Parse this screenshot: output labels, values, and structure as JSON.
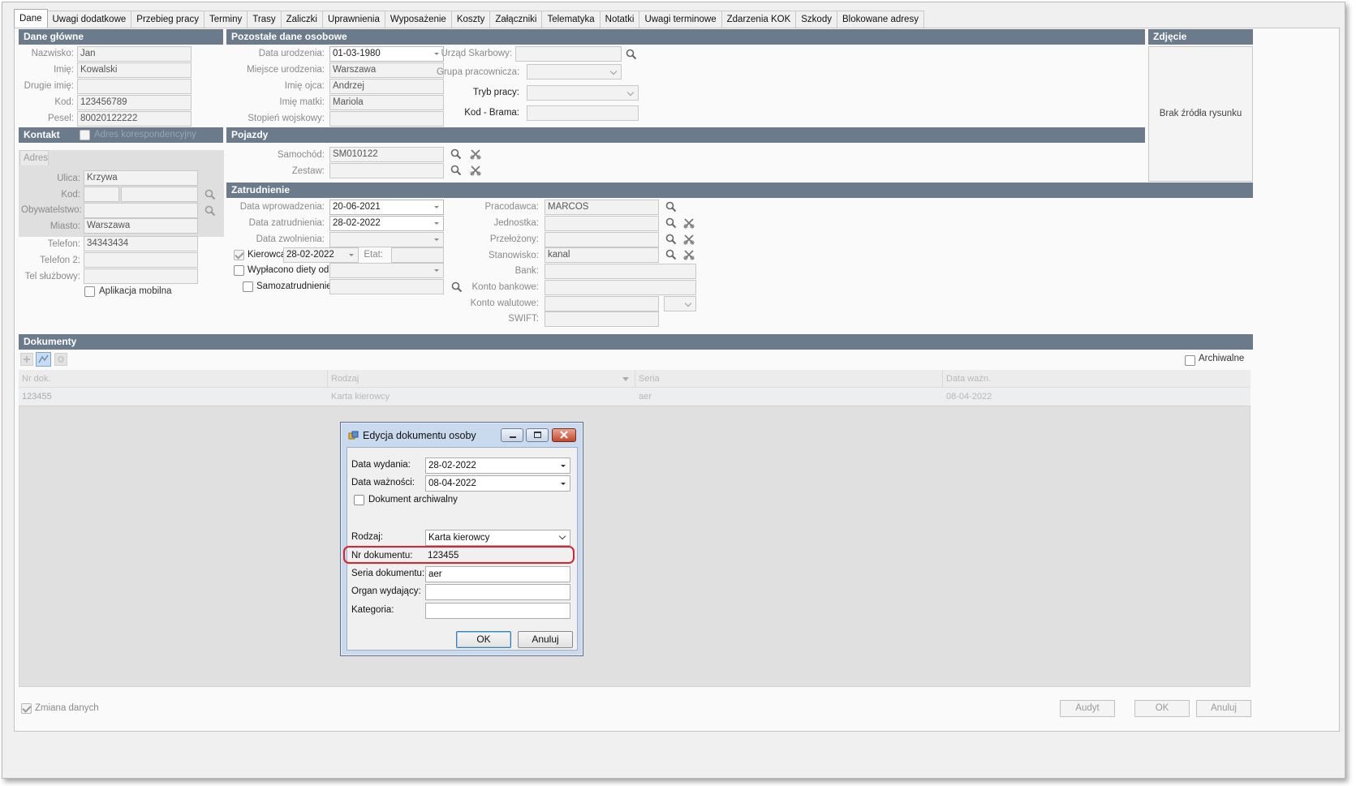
{
  "tabs": [
    "Dane",
    "Uwagi dodatkowe",
    "Przebieg pracy",
    "Terminy",
    "Trasy",
    "Zaliczki",
    "Uprawnienia",
    "Wyposażenie",
    "Koszty",
    "Załączniki",
    "Telematyka",
    "Notatki",
    "Uwagi terminowe",
    "Zdarzenia KOK",
    "Szkody",
    "Blokowane adresy"
  ],
  "sections": {
    "main": "Dane główne",
    "other": "Pozostałe dane osobowe",
    "photo": "Zdjęcie",
    "contact": "Kontakt",
    "vehicles": "Pojazdy",
    "employment": "Zatrudnienie",
    "documents": "Dokumenty"
  },
  "main": {
    "surname_label": "Nazwisko:",
    "surname": "Jan",
    "name_label": "Imię:",
    "name": "Kowalski",
    "second_name_label": "Drugie imię:",
    "second_name": "",
    "code_label": "Kod:",
    "code": "123456789",
    "pesel_label": "Pesel:",
    "pesel": "80020122222"
  },
  "other": {
    "birth_date_label": "Data urodzenia:",
    "birth_date": "01-03-1980",
    "birth_place_label": "Miejsce urodzenia:",
    "birth_place": "Warszawa",
    "father_label": "Imię ojca:",
    "father": "Andrzej",
    "mother_label": "Imię matki:",
    "mother": "Mariola",
    "military_label": "Stopień wojskowy:",
    "military": "",
    "tax_office_label": "Urząd Skarbowy:",
    "tax_office": "",
    "group_label": "Grupa pracownicza:",
    "group": "",
    "work_mode_label": "Tryb pracy:",
    "work_mode": "",
    "gate_code_label": "Kod - Brama:",
    "gate_code": ""
  },
  "photo": {
    "placeholder": "Brak źródła rysunku"
  },
  "contact": {
    "correspondence_label": "Adres korespondencyjny",
    "address_tab": "Adres",
    "street_label": "Ulica:",
    "street": "Krzywa",
    "code_label": "Kod:",
    "code_a": "",
    "code_b": "",
    "citizenship_label": "Obywatelstwo:",
    "citizenship": "",
    "city_label": "Miasto:",
    "city": "Warszawa",
    "phone_label": "Telefon:",
    "phone": "34343434",
    "phone2_label": "Telefon 2:",
    "phone2": "",
    "work_phone_label": "Tel służbowy:",
    "work_phone": "",
    "mobile_app_label": "Aplikacja mobilna"
  },
  "vehicles": {
    "car_label": "Samochód:",
    "car": "SM010122",
    "set_label": "Zestaw:",
    "set": ""
  },
  "employment": {
    "entry_date_label": "Data wprowadzenia:",
    "entry_date": "20-06-2021",
    "hire_date_label": "Data zatrudnienia:",
    "hire_date": "28-02-2022",
    "dismissal_label": "Data zwolnienia:",
    "dismissal": "",
    "driver_label": "Kierowca",
    "driver_date": "28-02-2022",
    "fte_label": "Etat:",
    "fte": "",
    "diet_label": "Wypłacono diety od:",
    "diet": "",
    "self_emp_label": "Samozatrudnienie:",
    "self_emp": "",
    "employer_label": "Pracodawca:",
    "employer": "MARCOS",
    "unit_label": "Jednostka:",
    "unit": "",
    "supervisor_label": "Przełożony:",
    "supervisor": "",
    "position_label": "Stanowisko:",
    "position": "kanal",
    "bank_label": "Bank:",
    "bank": "",
    "bank_account_label": "Konto bankowe:",
    "bank_account": "",
    "fx_account_label": "Konto walutowe:",
    "fx_account": "",
    "fx_currency": "",
    "swift_label": "SWIFT:",
    "swift": ""
  },
  "documents": {
    "archived_label": "Archiwalne",
    "columns": [
      "Nr dok.",
      "Rodzaj",
      "Seria",
      "Data ważn."
    ],
    "rows": [
      [
        "123455",
        "Karta kierowcy",
        "aer",
        "08-04-2022"
      ]
    ]
  },
  "footer": {
    "change_label": "Zmiana danych",
    "audit": "Audyt",
    "ok": "OK",
    "cancel": "Anuluj"
  },
  "dialog": {
    "title": "Edycja dokumentu osoby",
    "issue_date_label": "Data wydania:",
    "issue_date": "28-02-2022",
    "valid_date_label": "Data ważności:",
    "valid_date": "08-04-2022",
    "archived_label": "Dokument archiwalny",
    "kind_label": "Rodzaj:",
    "kind": "Karta kierowcy",
    "number_label": "Nr dokumentu:",
    "number": "123455",
    "series_label": "Seria dokumentu:",
    "series": "aer",
    "issuer_label": "Organ wydający:",
    "issuer": "",
    "category_label": "Kategoria:",
    "category": "",
    "ok": "OK",
    "cancel": "Anuluj",
    "highlight_color": "#e0202a"
  }
}
